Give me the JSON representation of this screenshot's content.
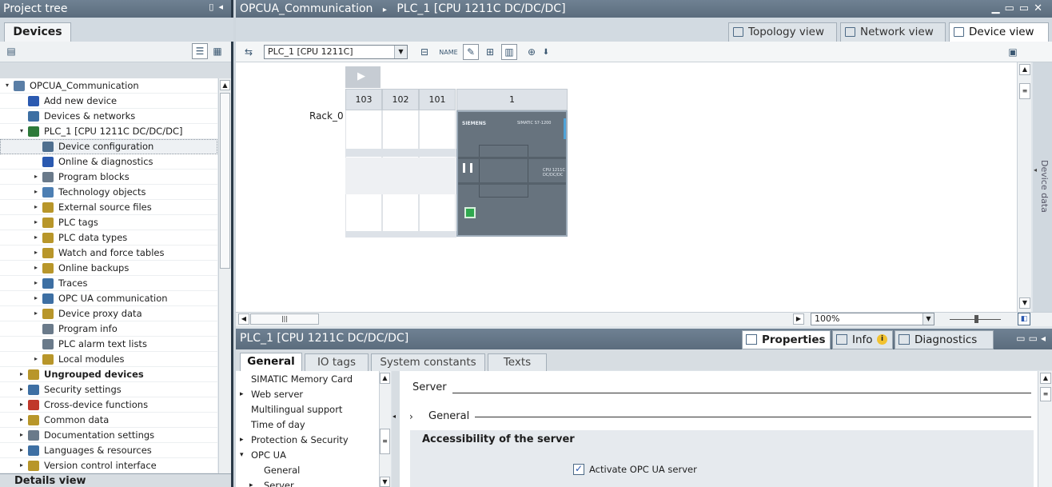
{
  "project_tree": {
    "title": "Project tree",
    "devices_tab": "Devices",
    "items": [
      {
        "label": "OPCUA_Communication",
        "level": 0,
        "expander": "▾",
        "icon_color": "#5a7ea6"
      },
      {
        "label": "Add new device",
        "level": 1,
        "expander": "",
        "icon_color": "#2a59b0"
      },
      {
        "label": "Devices & networks",
        "level": 1,
        "expander": "",
        "icon_color": "#3d6fa3"
      },
      {
        "label": "PLC_1 [CPU 1211C DC/DC/DC]",
        "level": 1,
        "expander": "▾",
        "icon_color": "#2d7a3a"
      },
      {
        "label": "Device configuration",
        "level": 2,
        "expander": "",
        "icon_color": "#4f6f8f",
        "selected": true
      },
      {
        "label": "Online & diagnostics",
        "level": 2,
        "expander": "",
        "icon_color": "#2a59b0"
      },
      {
        "label": "Program blocks",
        "level": 2,
        "expander": "▸",
        "icon_color": "#6a7a8a"
      },
      {
        "label": "Technology objects",
        "level": 2,
        "expander": "▸",
        "icon_color": "#4d7fb3"
      },
      {
        "label": "External source files",
        "level": 2,
        "expander": "▸",
        "icon_color": "#b8962a"
      },
      {
        "label": "PLC tags",
        "level": 2,
        "expander": "▸",
        "icon_color": "#b8962a"
      },
      {
        "label": "PLC data types",
        "level": 2,
        "expander": "▸",
        "icon_color": "#b8962a"
      },
      {
        "label": "Watch and force tables",
        "level": 2,
        "expander": "▸",
        "icon_color": "#b8962a"
      },
      {
        "label": "Online backups",
        "level": 2,
        "expander": "▸",
        "icon_color": "#b8962a"
      },
      {
        "label": "Traces",
        "level": 2,
        "expander": "▸",
        "icon_color": "#3d6fa3"
      },
      {
        "label": "OPC UA communication",
        "level": 2,
        "expander": "▸",
        "icon_color": "#3d6fa3"
      },
      {
        "label": "Device proxy data",
        "level": 2,
        "expander": "▸",
        "icon_color": "#b8962a"
      },
      {
        "label": "Program info",
        "level": 2,
        "expander": "",
        "icon_color": "#6a7a8a"
      },
      {
        "label": "PLC alarm text lists",
        "level": 2,
        "expander": "",
        "icon_color": "#6a7a8a"
      },
      {
        "label": "Local modules",
        "level": 2,
        "expander": "▸",
        "icon_color": "#b8962a"
      },
      {
        "label": "Ungrouped devices",
        "level": 1,
        "expander": "▸",
        "icon_color": "#b8962a",
        "bold": true
      },
      {
        "label": "Security settings",
        "level": 1,
        "expander": "▸",
        "icon_color": "#3d6fa3"
      },
      {
        "label": "Cross-device functions",
        "level": 1,
        "expander": "▸",
        "icon_color": "#c0392b"
      },
      {
        "label": "Common data",
        "level": 1,
        "expander": "▸",
        "icon_color": "#b8962a"
      },
      {
        "label": "Documentation settings",
        "level": 1,
        "expander": "▸",
        "icon_color": "#6a7a8a"
      },
      {
        "label": "Languages & resources",
        "level": 1,
        "expander": "▸",
        "icon_color": "#3d6fa3"
      },
      {
        "label": "Version control interface",
        "level": 1,
        "expander": "▸",
        "icon_color": "#b8962a"
      }
    ],
    "details_view": "Details view"
  },
  "breadcrumb": {
    "project": "OPCUA_Communication",
    "separator": "▸",
    "device": "PLC_1 [CPU 1211C DC/DC/DC]"
  },
  "view_tabs": {
    "topology": "Topology view",
    "network": "Network view",
    "device": "Device view"
  },
  "device_toolbar": {
    "selected_device": "PLC_1 [CPU 1211C]"
  },
  "rack": {
    "name": "Rack_0",
    "slots": [
      "103",
      "102",
      "101",
      "1"
    ],
    "cpu_brand": "SIEMENS",
    "cpu_model_top": "SIMATIC S7-1200",
    "cpu_model_side": "CPU 1211C DC/DC/DC"
  },
  "zoom": {
    "value": "100%"
  },
  "inspector": {
    "title": "PLC_1 [CPU 1211C DC/DC/DC]",
    "tabs_right": {
      "properties": "Properties",
      "info": "Info",
      "diagnostics": "Diagnostics"
    },
    "tabs": [
      "General",
      "IO tags",
      "System constants",
      "Texts"
    ],
    "nav": [
      {
        "label": "SIMATIC Memory Card",
        "expander": "",
        "indent": 0
      },
      {
        "label": "Web server",
        "expander": "▸",
        "indent": 0
      },
      {
        "label": "Multilingual support",
        "expander": "",
        "indent": 0
      },
      {
        "label": "Time of day",
        "expander": "",
        "indent": 0
      },
      {
        "label": "Protection & Security",
        "expander": "▸",
        "indent": 0
      },
      {
        "label": "OPC UA",
        "expander": "▾",
        "indent": 0
      },
      {
        "label": "General",
        "expander": "",
        "indent": 1
      },
      {
        "label": "Server",
        "expander": "▸",
        "indent": 1
      }
    ],
    "server_heading": "Server",
    "general_section": "General",
    "general_expander": "›",
    "accessibility_heading": "Accessibility of the server",
    "activate_label": "Activate OPC UA server",
    "activate_checked": true
  }
}
